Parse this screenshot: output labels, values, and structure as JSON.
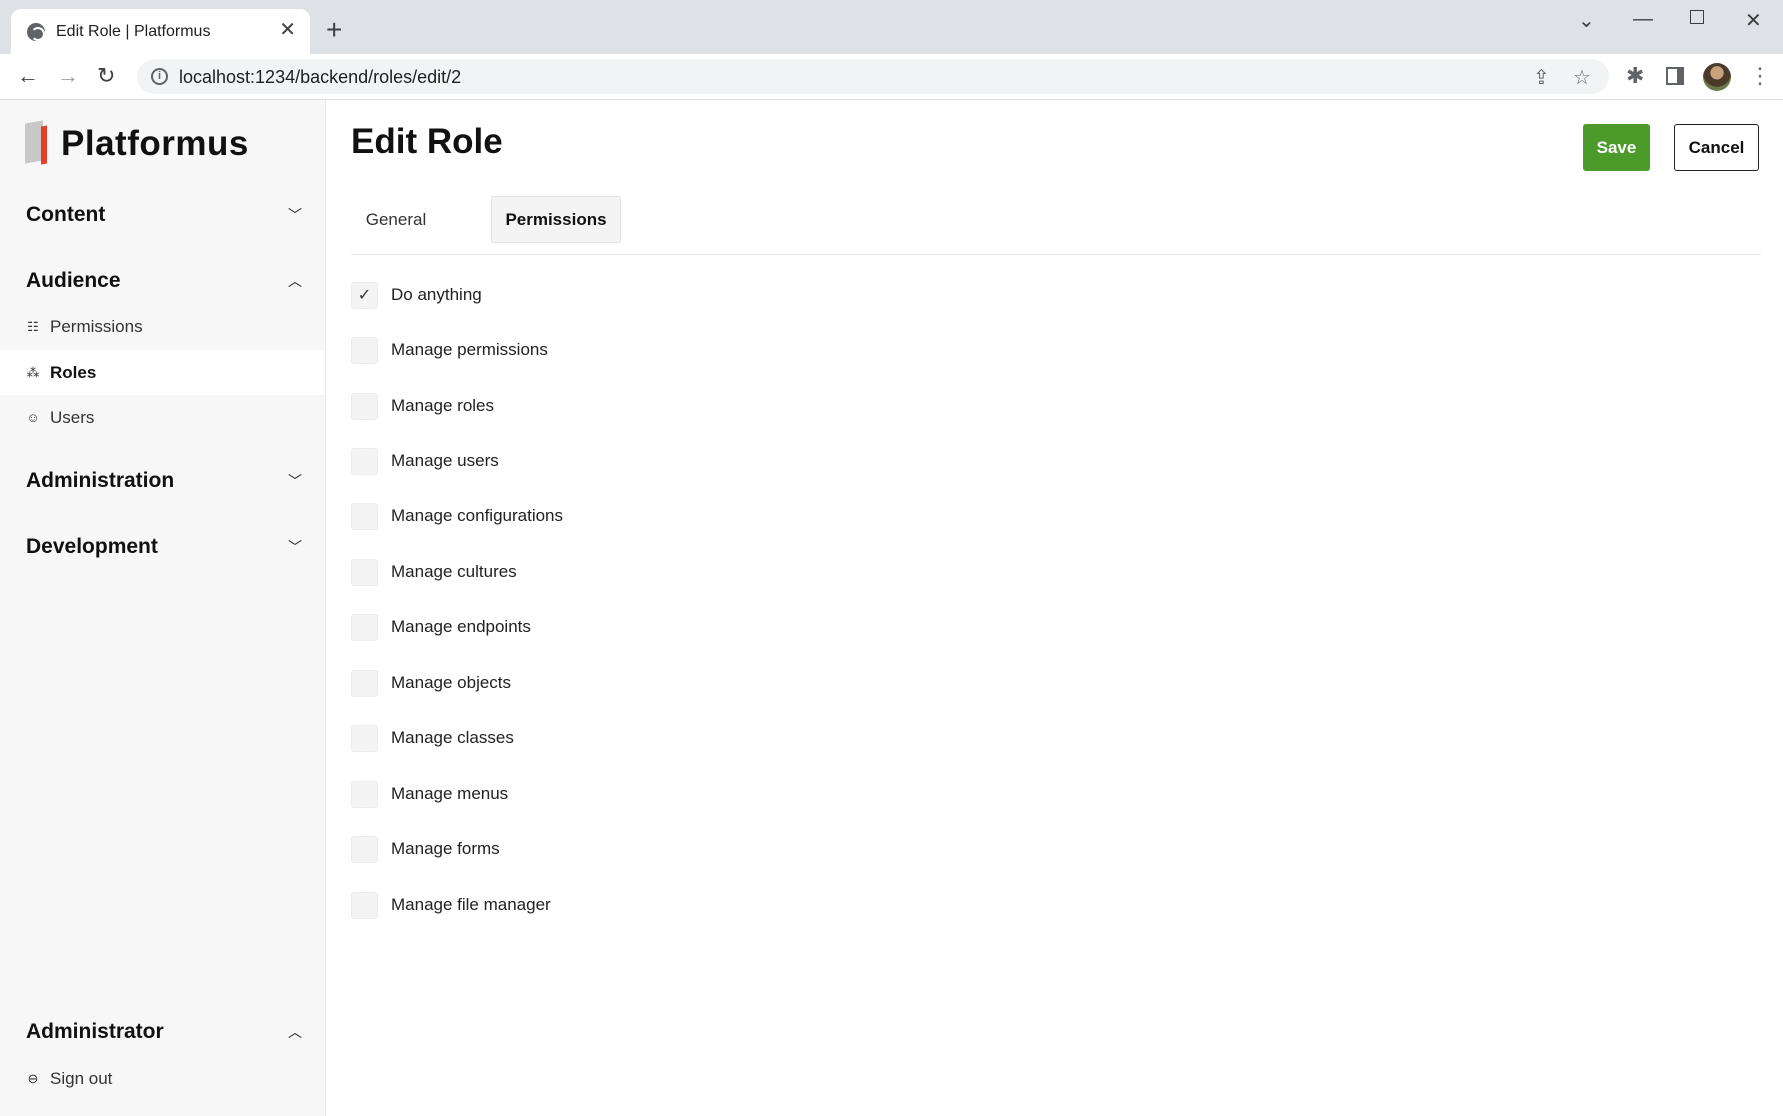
{
  "browser": {
    "tab_title": "Edit Role | Platformus",
    "tab_close": "✕",
    "new_tab": "+",
    "url": "localhost:1234/backend/roles/edit/2"
  },
  "sidebar": {
    "logo": "Platformus",
    "groups": {
      "content": "Content",
      "audience": "Audience",
      "administration": "Administration",
      "development": "Development",
      "administrator": "Administrator"
    },
    "audience_items": [
      {
        "label": "Permissions",
        "icon": "permissions-icon"
      },
      {
        "label": "Roles",
        "icon": "roles-icon",
        "active": true
      },
      {
        "label": "Users",
        "icon": "users-icon"
      }
    ],
    "sign_out": "Sign out"
  },
  "main": {
    "title": "Edit Role",
    "save_label": "Save",
    "cancel_label": "Cancel",
    "tabs": [
      {
        "label": "General"
      },
      {
        "label": "Permissions",
        "active": true
      }
    ],
    "permissions": [
      {
        "label": "Do anything",
        "checked": true
      },
      {
        "label": "Manage permissions",
        "checked": false
      },
      {
        "label": "Manage roles",
        "checked": false
      },
      {
        "label": "Manage users",
        "checked": false
      },
      {
        "label": "Manage configurations",
        "checked": false
      },
      {
        "label": "Manage cultures",
        "checked": false
      },
      {
        "label": "Manage endpoints",
        "checked": false
      },
      {
        "label": "Manage objects",
        "checked": false
      },
      {
        "label": "Manage classes",
        "checked": false
      },
      {
        "label": "Manage menus",
        "checked": false
      },
      {
        "label": "Manage forms",
        "checked": false
      },
      {
        "label": "Manage file manager",
        "checked": false
      }
    ]
  },
  "colors": {
    "save_button": "#4c9a2a",
    "logo_accent": "#e2402a",
    "sidebar_bg": "#f7f7f7"
  }
}
